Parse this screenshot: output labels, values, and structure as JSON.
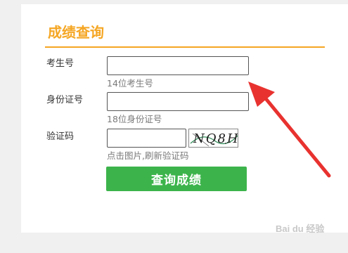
{
  "form": {
    "title": "成绩查询",
    "exam_number": {
      "label": "考生号",
      "value": "",
      "hint": "14位考生号"
    },
    "id_number": {
      "label": "身份证号",
      "value": "",
      "hint": "18位身份证号"
    },
    "captcha": {
      "label": "验证码",
      "value": "",
      "image_text": "NQ8H",
      "hint": "点击图片,刷新验证码"
    },
    "submit_label": "查询成绩"
  },
  "annotation": {
    "arrow_color": "#e8322f",
    "arrow_target": "exam-number-input"
  },
  "watermark": {
    "text": "Bai du 经验"
  },
  "colors": {
    "accent": "#f5a623",
    "button": "#3cb44b",
    "hint": "#7a7a7a"
  }
}
